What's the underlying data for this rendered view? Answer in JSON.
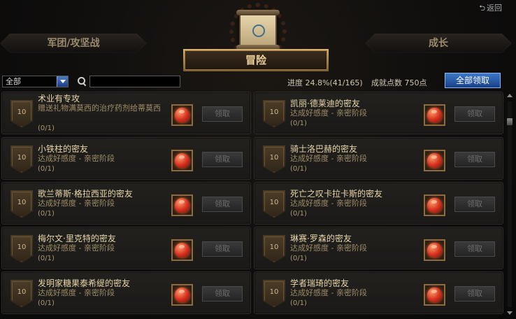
{
  "header": {
    "back_label": "返回",
    "tabs": {
      "left": "军团/攻坚战",
      "center": "冒险",
      "right": "成长"
    }
  },
  "filter": {
    "category_selected": "全部",
    "search_value": "",
    "search_placeholder": ""
  },
  "summary": {
    "progress_label": "进度",
    "progress_value": "24.8%(41/165)",
    "points_label": "成就点数",
    "points_value": "750点",
    "claim_all_label": "全部领取"
  },
  "achievements": [
    {
      "level": "10",
      "title": "术业有专攻",
      "desc": "赠送礼物满莫西的治疗药剂给蒂莫西",
      "count": "(0/1)",
      "reward_icon": "heart-gem-icon",
      "claim_label": "领取"
    },
    {
      "level": "10",
      "title": "凯丽·德莱迪的密友",
      "desc": "达成好感度 - 亲密阶段",
      "count": "(0/1)",
      "reward_icon": "heart-gem-icon",
      "claim_label": "领取"
    },
    {
      "level": "10",
      "title": "小铁柱的密友",
      "desc": "达成好感度 - 亲密阶段",
      "count": "(0/1)",
      "reward_icon": "heart-gem-icon",
      "claim_label": "领取"
    },
    {
      "level": "10",
      "title": "骑士洛巴赫的密友",
      "desc": "达成好感度 - 亲密阶段",
      "count": "(0/1)",
      "reward_icon": "heart-gem-icon",
      "claim_label": "领取"
    },
    {
      "level": "10",
      "title": "歌兰蒂斯·格拉西亚的密友",
      "desc": "达成好感度 - 亲密阶段",
      "count": "(0/1)",
      "reward_icon": "heart-gem-icon",
      "claim_label": "领取"
    },
    {
      "level": "10",
      "title": "死亡之叹卡拉卡斯的密友",
      "desc": "达成好感度 - 亲密阶段",
      "count": "(0/1)",
      "reward_icon": "heart-gem-icon",
      "claim_label": "领取"
    },
    {
      "level": "10",
      "title": "梅尔文·里克特的密友",
      "desc": "达成好感度 - 亲密阶段",
      "count": "(0/1)",
      "reward_icon": "heart-gem-icon",
      "claim_label": "领取"
    },
    {
      "level": "10",
      "title": "琳赛·罗森的密友",
      "desc": "达成好感度 - 亲密阶段",
      "count": "(0/1)",
      "reward_icon": "heart-gem-icon",
      "claim_label": "领取"
    },
    {
      "level": "10",
      "title": "发明家糖果泰希缇的密友",
      "desc": "达成好感度 - 亲密阶段",
      "count": "(0/1)",
      "reward_icon": "heart-gem-icon",
      "claim_label": "领取"
    },
    {
      "level": "10",
      "title": "学者瑞琦的密友",
      "desc": "达成好感度 - 亲密阶段",
      "count": "(0/1)",
      "reward_icon": "heart-gem-icon",
      "claim_label": "领取"
    }
  ],
  "colors": {
    "accent_gold": "#d9b36e",
    "claim_all_blue": "#2b5cab",
    "title_text": "#e8d6aa"
  }
}
